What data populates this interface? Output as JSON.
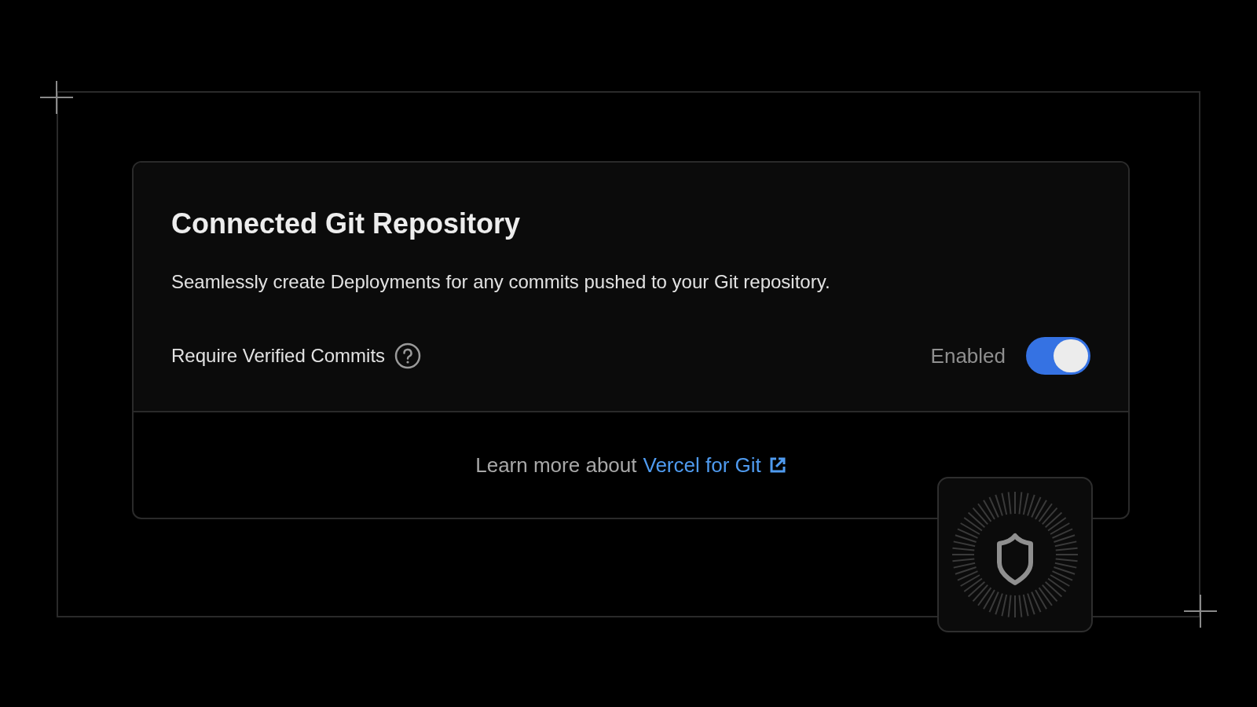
{
  "card": {
    "title": "Connected Git Repository",
    "description": "Seamlessly create Deployments for any commits pushed to your Git repository.",
    "setting": {
      "label": "Require Verified Commits",
      "status": "Enabled",
      "on": true
    },
    "footer": {
      "text": "Learn more about",
      "link": "Vercel for Git"
    }
  }
}
